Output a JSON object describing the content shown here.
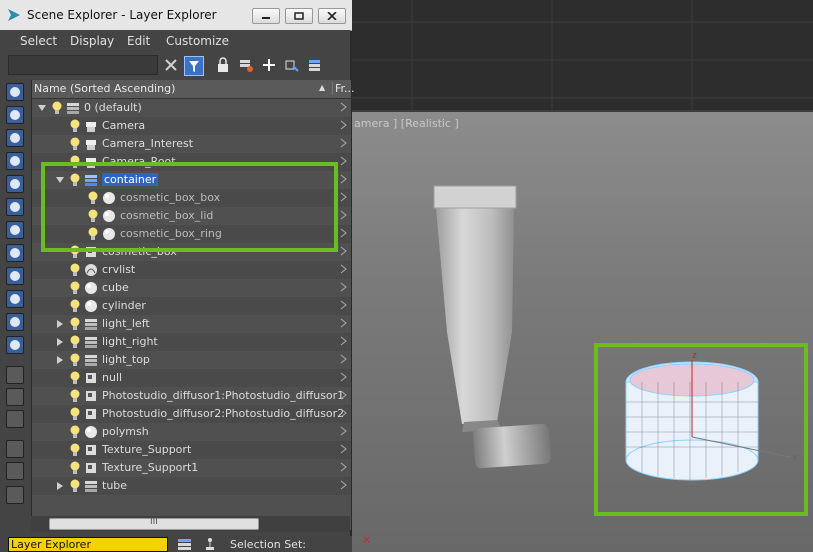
{
  "window": {
    "title": "Scene Explorer - Layer Explorer"
  },
  "menu": {
    "select": "Select",
    "display": "Display",
    "edit": "Edit",
    "customize": "Customize"
  },
  "tree": {
    "header_name": "Name (Sorted Ascending)",
    "header_sort": "▲",
    "header_fr": "Fr...",
    "rows": [
      {
        "label": "0 (default)"
      },
      {
        "label": "Camera"
      },
      {
        "label": "Camera_Interest"
      },
      {
        "label": "Camera_Root"
      },
      {
        "label": "container"
      },
      {
        "label": "cosmetic_box_box"
      },
      {
        "label": "cosmetic_box_lid"
      },
      {
        "label": "cosmetic_box_ring"
      },
      {
        "label": "cosmetic_box"
      },
      {
        "label": "crvlist"
      },
      {
        "label": "cube"
      },
      {
        "label": "cylinder"
      },
      {
        "label": "light_left"
      },
      {
        "label": "light_right"
      },
      {
        "label": "light_top"
      },
      {
        "label": "null"
      },
      {
        "label": "Photostudio_diffusor1:Photostudio_diffusor1"
      },
      {
        "label": "Photostudio_diffusor2:Photostudio_diffusor2"
      },
      {
        "label": "polymsh"
      },
      {
        "label": "Texture_Support"
      },
      {
        "label": "Texture_Support1"
      },
      {
        "label": "tube"
      }
    ]
  },
  "scroll": {
    "grip": "III"
  },
  "bottom": {
    "explorer_select": "Layer Explorer",
    "selection_set_label": "Selection Set:"
  },
  "viewport": {
    "label": "amera ] [Realistic ]",
    "axis_z": "z",
    "axis_x": "x"
  },
  "colors": {
    "highlight": "#6bbd1f",
    "selection": "#2e65c4",
    "accent": "#f7d000"
  }
}
